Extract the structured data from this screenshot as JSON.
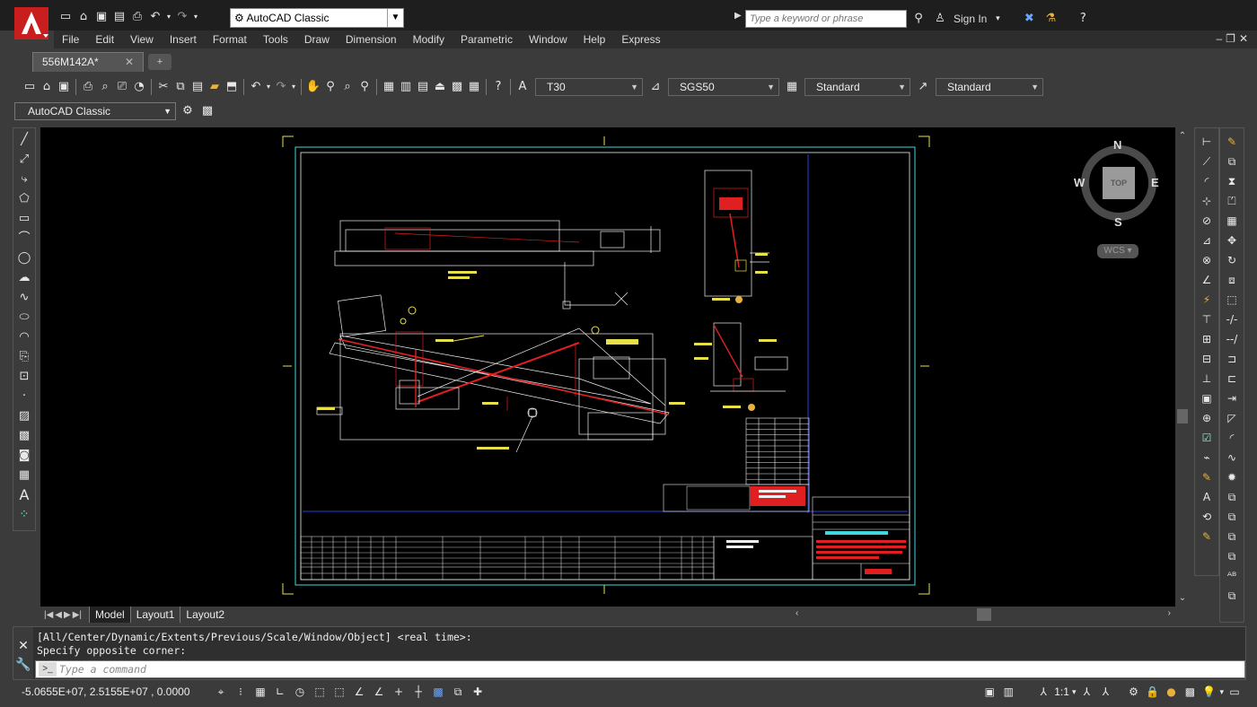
{
  "titlebar": {
    "workspace": "AutoCAD Classic",
    "search_placeholder": "Type a keyword or phrase",
    "sign_in": "Sign In"
  },
  "menu": [
    "File",
    "Edit",
    "View",
    "Insert",
    "Format",
    "Tools",
    "Draw",
    "Dimension",
    "Modify",
    "Parametric",
    "Window",
    "Help",
    "Express"
  ],
  "tabs": {
    "file_tab": "556M142A*"
  },
  "toolbar": {
    "text_style": "T30",
    "dim_style": "SGS50",
    "table_style": "Standard",
    "multileader_style": "Standard",
    "workspace_combo": "AutoCAD Classic"
  },
  "viewcube": {
    "north": "N",
    "south": "S",
    "east": "E",
    "west": "W",
    "face": "TOP",
    "ucs": "WCS"
  },
  "layout_tabs": [
    "Model",
    "Layout1",
    "Layout2"
  ],
  "command": {
    "history": [
      "[All/Center/Dynamic/Extents/Previous/Scale/Window/Object] <real time>:",
      "Specify opposite corner:"
    ],
    "placeholder": "Type a command"
  },
  "status": {
    "coordinates": "-5.0655E+07, 2.5155E+07 , 0.0000",
    "annotation_scale": "1:1"
  },
  "colors": {
    "drawing_bg": "#000000",
    "frame_yellow": "#e8e04a",
    "border_cyan": "#3fd8e0",
    "geometry_white": "#f0f0f0",
    "highlight_red": "#e02020",
    "blue_line": "#2a3ee0"
  },
  "icons": {
    "logo": "autocad-logo",
    "search": "binoculars-icon",
    "user": "user-icon",
    "help": "help-icon"
  }
}
